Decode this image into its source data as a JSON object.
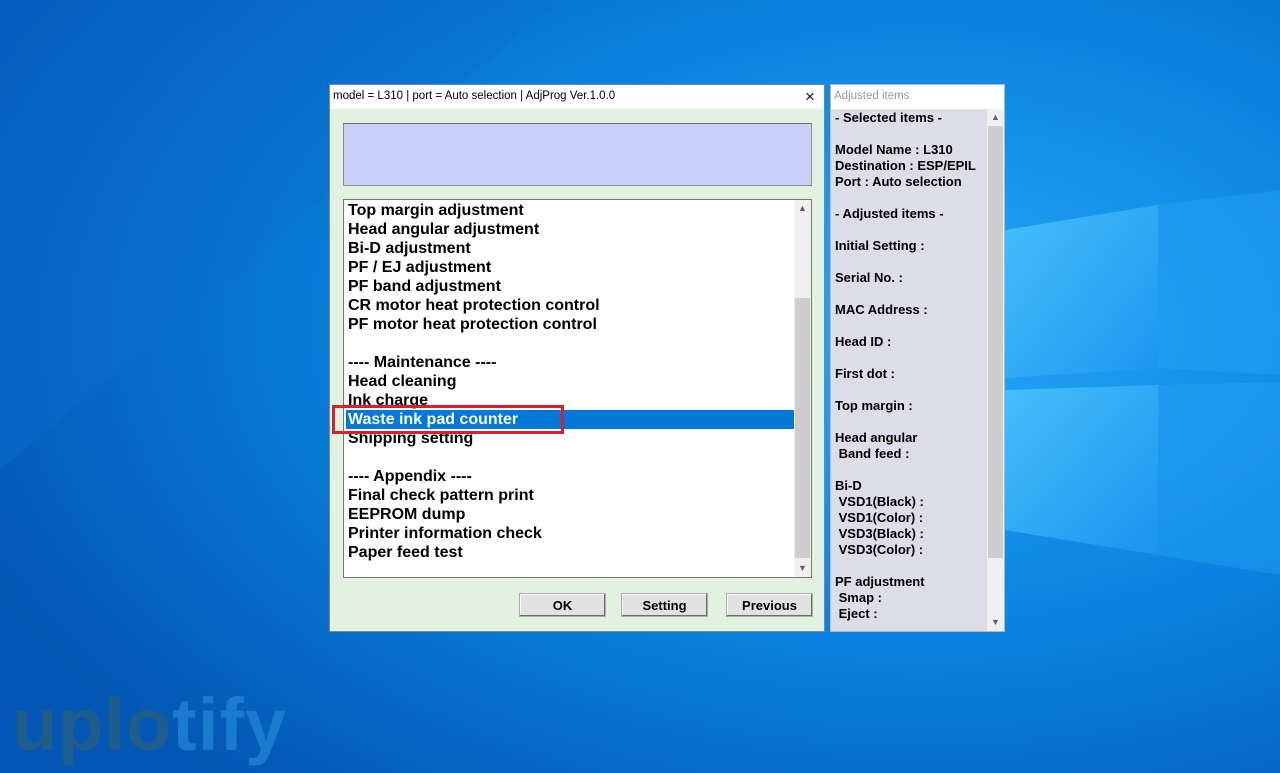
{
  "main_window": {
    "title": "model = L310 | port = Auto selection | AdjProg Ver.1.0.0",
    "close_icon": "×",
    "list_items": [
      "Top margin adjustment",
      "Head angular adjustment",
      "Bi-D adjustment",
      "PF / EJ adjustment",
      "PF band adjustment",
      "CR motor heat protection control",
      "PF motor heat protection control",
      "",
      "---- Maintenance ----",
      "Head cleaning",
      "Ink charge",
      "Waste ink pad counter",
      "Shipping setting",
      "",
      "---- Appendix ----",
      "Final check pattern print",
      "EEPROM dump",
      "Printer information check",
      "Paper feed test"
    ],
    "selected_item": "Waste ink pad counter",
    "buttons": {
      "ok": "OK",
      "setting": "Setting",
      "previous": "Previous"
    }
  },
  "side_window": {
    "title": "Adjusted items",
    "lines": [
      "- Selected items -",
      "",
      "Model Name : L310",
      "Destination : ESP/EPIL",
      "Port : Auto selection",
      "",
      "- Adjusted items -",
      "",
      "Initial Setting :",
      "",
      "Serial No. :",
      "",
      "MAC Address :",
      "",
      "Head ID :",
      "",
      "First dot :",
      "",
      "Top margin :",
      "",
      "Head angular",
      " Band feed :",
      "",
      "Bi-D",
      " VSD1(Black) :",
      " VSD1(Color) :",
      " VSD3(Black) :",
      " VSD3(Color) :",
      "",
      "PF adjustment",
      " Smap :",
      " Eject :"
    ]
  },
  "watermark": {
    "part1": "uplo",
    "part2": "tify"
  },
  "colors": {
    "desktop": "#0a78d7",
    "selection": "#0078d7",
    "highlight": "#d8202a"
  }
}
